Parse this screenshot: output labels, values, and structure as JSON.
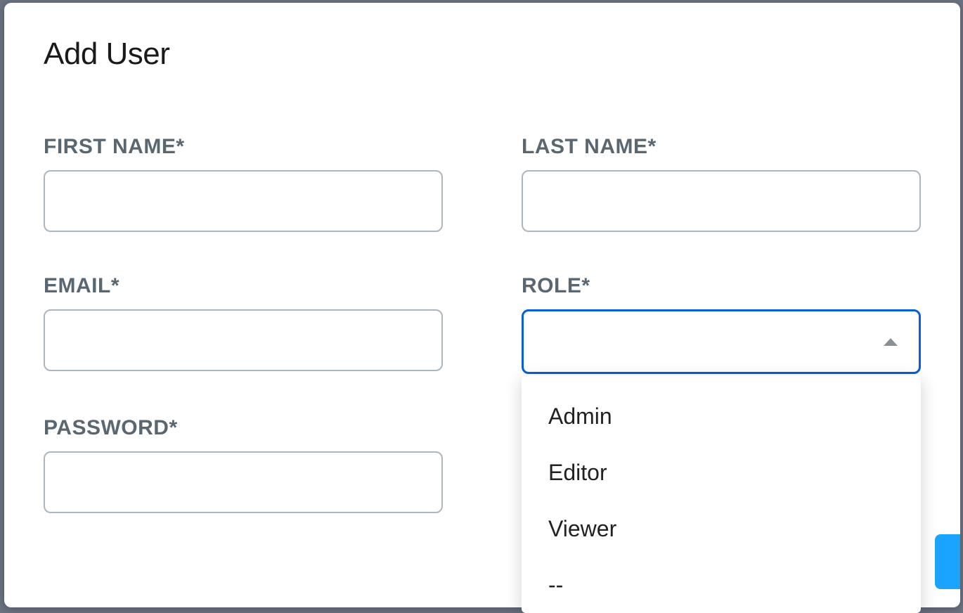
{
  "modal": {
    "title": "Add User"
  },
  "fields": {
    "first_name": {
      "label": "FIRST NAME*",
      "value": ""
    },
    "last_name": {
      "label": "LAST NAME*",
      "value": ""
    },
    "email": {
      "label": "EMAIL*",
      "value": ""
    },
    "role": {
      "label": "ROLE*",
      "selected": ""
    },
    "password": {
      "label": "PASSWORD*",
      "value": ""
    }
  },
  "role_options": [
    "Admin",
    "Editor",
    "Viewer",
    "--"
  ],
  "colors": {
    "focus_border": "#0a5ed7",
    "input_border": "#aeb6bd",
    "label_text": "#5a6670",
    "primary_button": "#1aa3ff"
  }
}
